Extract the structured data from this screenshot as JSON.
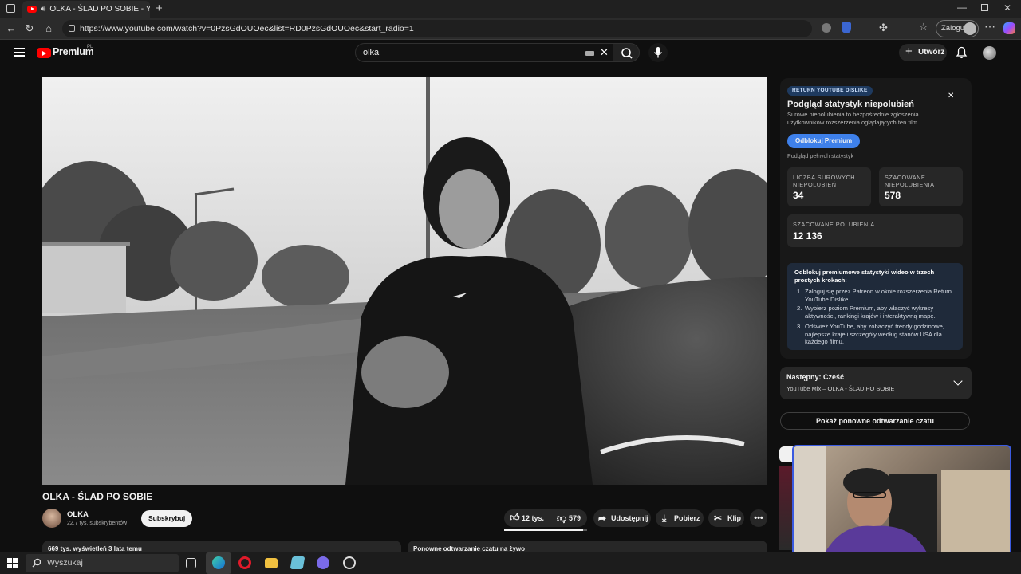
{
  "browser": {
    "tab_title": "OLKA - ŚLAD PO SOBIE - Yo",
    "url": "https://www.youtube.com/watch?v=0PzsGdOUOec&list=RD0PzsGdOUOec&start_radio=1",
    "login_label": "Zaloguj"
  },
  "youtube": {
    "logo_text": "Premium",
    "logo_region": "PL",
    "search_value": "olka",
    "create_label": "Utwórz"
  },
  "video": {
    "title": "OLKA - ŚLAD PO SOBIE",
    "channel": "OLKA",
    "subscribers": "22,7 tys. subskrybentów",
    "subscribe_label": "Subskrybuj",
    "likes": "12 tys.",
    "dislikes": "579",
    "share_label": "Udostępnij",
    "download_label": "Pobierz",
    "clip_label": "Klip",
    "description_teaser": "669 tys. wyświetleń  3 lata temu",
    "chat_teaser": "Ponowne odtwarzanie czatu na żywo"
  },
  "rdpanel": {
    "badge": "RETURN YOUTUBE DISLIKE",
    "title": "Podgląd statystyk niepolubień",
    "desc": "Surowe niepolubienia to bezpośrednie zgłoszenia użytkowników rozszerzenia oglądających ten film.",
    "unlock_btn": "Odblokuj Premium",
    "full_stats": "Podgląd pełnych statystyk",
    "raw_label": "LICZBA SUROWYCH NIEPOLUBIEŃ",
    "raw_value": "34",
    "est_dislike_label": "SZACOWANE NIEPOLUBIENIA",
    "est_dislike_value": "578",
    "est_like_label": "SZACOWANE POLUBIENIA",
    "est_like_value": "12 136",
    "info_title": "Odblokuj premiumowe statystyki wideo w trzech prostych krokach:",
    "steps": [
      "Zaloguj się przez Patreon w oknie rozszerzenia Return YouTube Dislike.",
      "Wybierz poziom Premium, aby włączyć wykresy aktywności, rankingi krajów i interaktywną mapę.",
      "Odśwież YouTube, aby zobaczyć trendy godzinowe, najlepsze kraje i szczegóły według stanów USA dla każdego filmu."
    ]
  },
  "next": {
    "label": "Następny: Cześć",
    "sub": "YouTube Mix – OLKA - ŚLAD PO SOBIE"
  },
  "chat_replay_label": "Pokaż ponowne odtwarzanie czatu",
  "taskbar": {
    "search_placeholder": "Wyszukaj"
  }
}
